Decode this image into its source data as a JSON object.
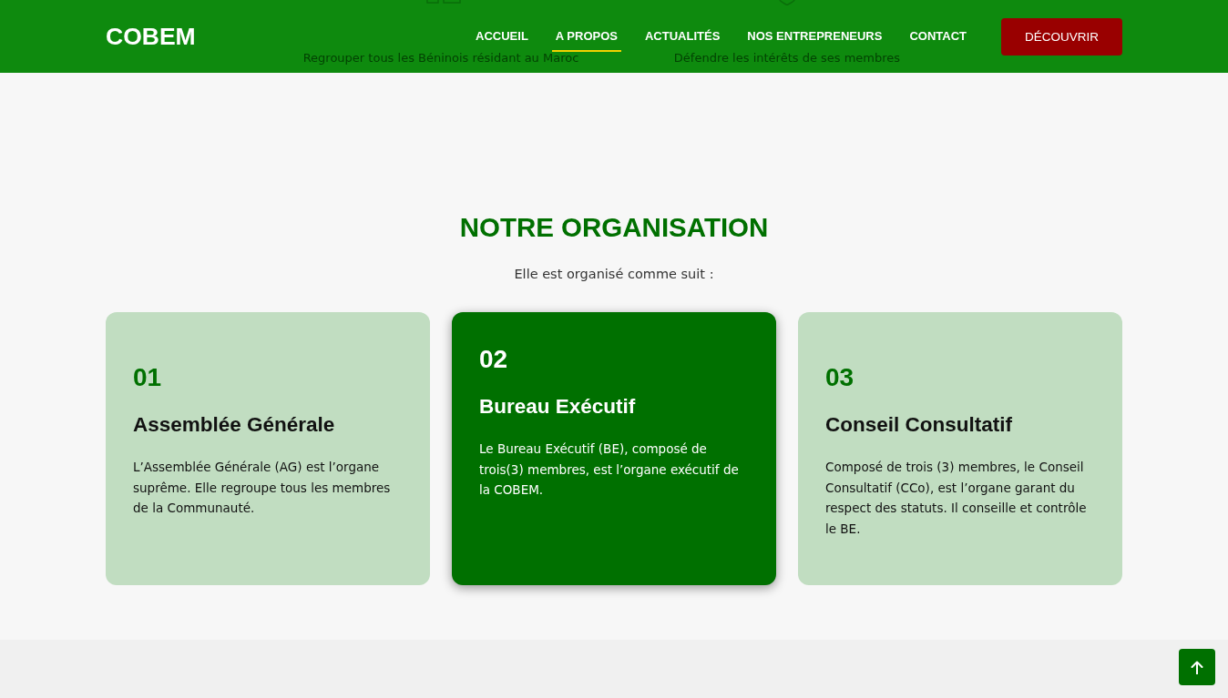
{
  "header": {
    "logo": "COBEM",
    "nav": [
      {
        "label": "ACCUEIL",
        "selected": false
      },
      {
        "label": "A PROPOS",
        "selected": true
      },
      {
        "label": "ACTUALITÉS",
        "selected": false
      },
      {
        "label": "NOS ENTREPRENEURS",
        "selected": false
      },
      {
        "label": "CONTACT",
        "selected": false
      }
    ],
    "cta": "DÉCOUVRIR"
  },
  "background_features": [
    {
      "text": "Regrouper tous les Béninois résidant au Maroc"
    },
    {
      "text": "Défendre les intérêts de ses membres"
    }
  ],
  "section": {
    "title": "NOTRE ORGANISATION",
    "subtitle": "Elle est organisé comme suit :",
    "cards": [
      {
        "number": "01",
        "title": "Assemblée Générale",
        "text": "L’Assemblée Générale (AG) est l’organe suprême. Elle regroupe tous les membres de la Communauté.",
        "highlighted": false
      },
      {
        "number": "02",
        "title": "Bureau Exécutif",
        "text": "Le Bureau Exécutif (BE), composé de trois(3) membres, est l’organe exécutif de la COBEM.",
        "highlighted": true
      },
      {
        "number": "03",
        "title": "Conseil Consultatif",
        "text": "Composé de trois (3) membres, le Conseil Consultatif (CCo), est l’organe garant du respect des statuts. Il conseille et contrôle le BE.",
        "highlighted": false
      }
    ]
  }
}
